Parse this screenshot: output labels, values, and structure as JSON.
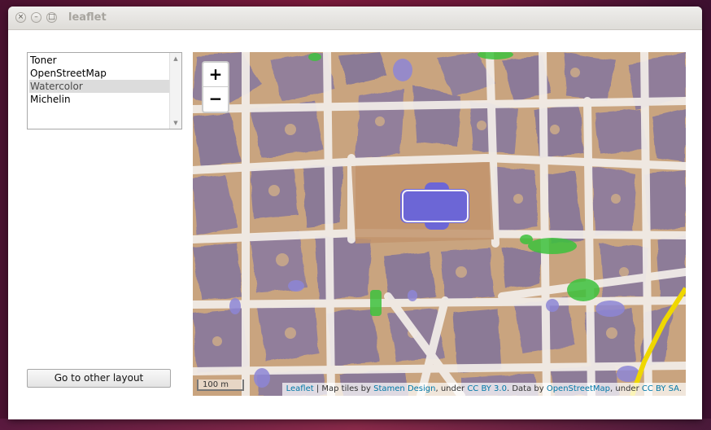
{
  "window": {
    "title": "leaflet",
    "close_glyph": "×",
    "minimize_glyph": "–",
    "maximize_glyph": "□"
  },
  "layer_list": {
    "items": [
      {
        "label": "Toner",
        "selected": false
      },
      {
        "label": "OpenStreetMap",
        "selected": false
      },
      {
        "label": "Watercolor",
        "selected": true
      },
      {
        "label": "Michelin",
        "selected": false
      }
    ],
    "scroll_up_icon": "▲",
    "scroll_down_icon": "▼"
  },
  "layout_button": {
    "label": "Go to other layout"
  },
  "map": {
    "zoom_in_label": "+",
    "zoom_out_label": "−",
    "scale_label": "100 m",
    "attribution": {
      "leaflet": "Leaflet",
      "sep": " | Map tiles by ",
      "stamen": "Stamen Design",
      "under1": ", under ",
      "cc_by": "CC BY 3.0",
      "data_by": ". Data by ",
      "osm": "OpenStreetMap",
      "under2": ", under ",
      "cc_by_sa": "CC BY SA",
      "end": "."
    },
    "colors": {
      "land": "#c8a47e",
      "block": "#8e7c98",
      "street": "#f2ece8",
      "park": "#3fbf3f",
      "cathedral": "#6e67d6",
      "highway": "#f0d800"
    }
  }
}
